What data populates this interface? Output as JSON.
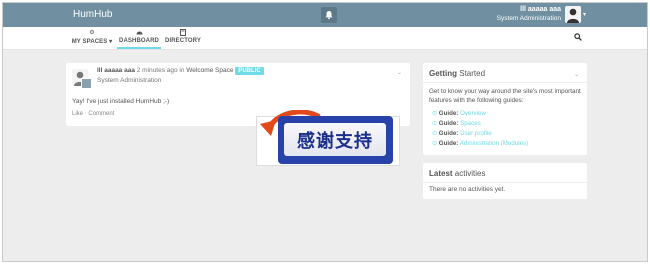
{
  "app": {
    "brand": "HumHub"
  },
  "user": {
    "name": "lll aaaaa aaa",
    "role": "System Administration"
  },
  "nav": {
    "items": [
      {
        "label": "MY SPACES",
        "icon": "cog-icon",
        "has_caret": true
      },
      {
        "label": "DASHBOARD",
        "icon": "dashboard-icon",
        "active": true
      },
      {
        "label": "DIRECTORY",
        "icon": "book-icon"
      }
    ]
  },
  "post": {
    "author": "lll aaaaa aaa",
    "time": "2 minutes ago in",
    "space": "Welcome Space",
    "visibility": "PUBLIC",
    "subtitle": "System Administration",
    "body": "Yay! I've just installed HumHub ;-)",
    "like": "Like",
    "separator": "·",
    "comment": "Comment"
  },
  "promo": {
    "text": "感谢支持"
  },
  "getting_started": {
    "title_bold": "Getting",
    "title_rest": "Started",
    "description": "Get to know your way around the site's most important features with the following guides:",
    "guide_prefix": "Guide:",
    "guides": [
      "Overview",
      "Spaces",
      "User profile",
      "Administration (Modules)"
    ]
  },
  "latest_activities": {
    "title_bold": "Latest",
    "title_rest": "activities",
    "empty": "There are no activities yet."
  },
  "colors": {
    "topbar": "#708fa0",
    "accent": "#6fdbe8",
    "background": "#ededed",
    "promo_blue": "#2742a8"
  }
}
